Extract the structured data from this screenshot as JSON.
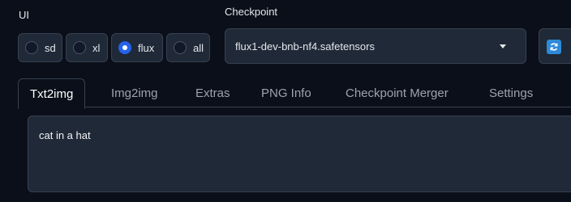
{
  "ui_filter": {
    "label": "UI",
    "options": [
      {
        "label": "sd",
        "checked": false
      },
      {
        "label": "xl",
        "checked": false
      },
      {
        "label": "flux",
        "checked": true
      },
      {
        "label": "all",
        "checked": false
      }
    ]
  },
  "checkpoint": {
    "label": "Checkpoint",
    "selected": "flux1-dev-bnb-nf4.safetensors",
    "refresh_icon": "refresh-icon",
    "accent": "#2e8ad8"
  },
  "tabs": [
    {
      "label": "Txt2img",
      "active": true
    },
    {
      "label": "Img2img",
      "active": false
    },
    {
      "label": "Extras",
      "active": false
    },
    {
      "label": "PNG Info",
      "active": false
    },
    {
      "label": "Checkpoint Merger",
      "active": false
    },
    {
      "label": "Settings",
      "active": false
    }
  ],
  "prompt": {
    "value": "cat in a hat"
  },
  "colors": {
    "background": "#0b0f19",
    "panel": "#1f2937",
    "border": "#374151",
    "radio_active": "#2563eb"
  }
}
